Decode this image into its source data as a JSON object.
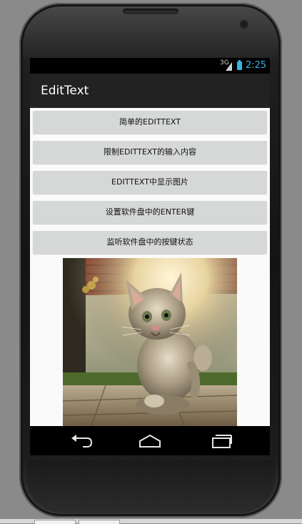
{
  "status_bar": {
    "network_label": "3G",
    "time": "2:25",
    "icons": [
      "signal-icon",
      "battery-charging-icon"
    ]
  },
  "action_bar": {
    "title": "EditText"
  },
  "buttons": [
    {
      "label": "简单的EDITTEXT"
    },
    {
      "label": "限制EDITTEXT的输入内容"
    },
    {
      "label": "EDITTEXT中显示图片"
    },
    {
      "label": "设置软件盘中的ENTER键"
    },
    {
      "label": "监听软件盘中的按键状态"
    }
  ],
  "image": {
    "subject": "kitten-photo"
  },
  "navigation_bar": {
    "icons": [
      "back-icon",
      "home-icon",
      "recent-apps-icon"
    ]
  },
  "colors": {
    "accent": "#33b5e5",
    "action_bar_bg": "#222222",
    "button_bg": "#d6d7d7",
    "content_bg": "#fafafa"
  }
}
